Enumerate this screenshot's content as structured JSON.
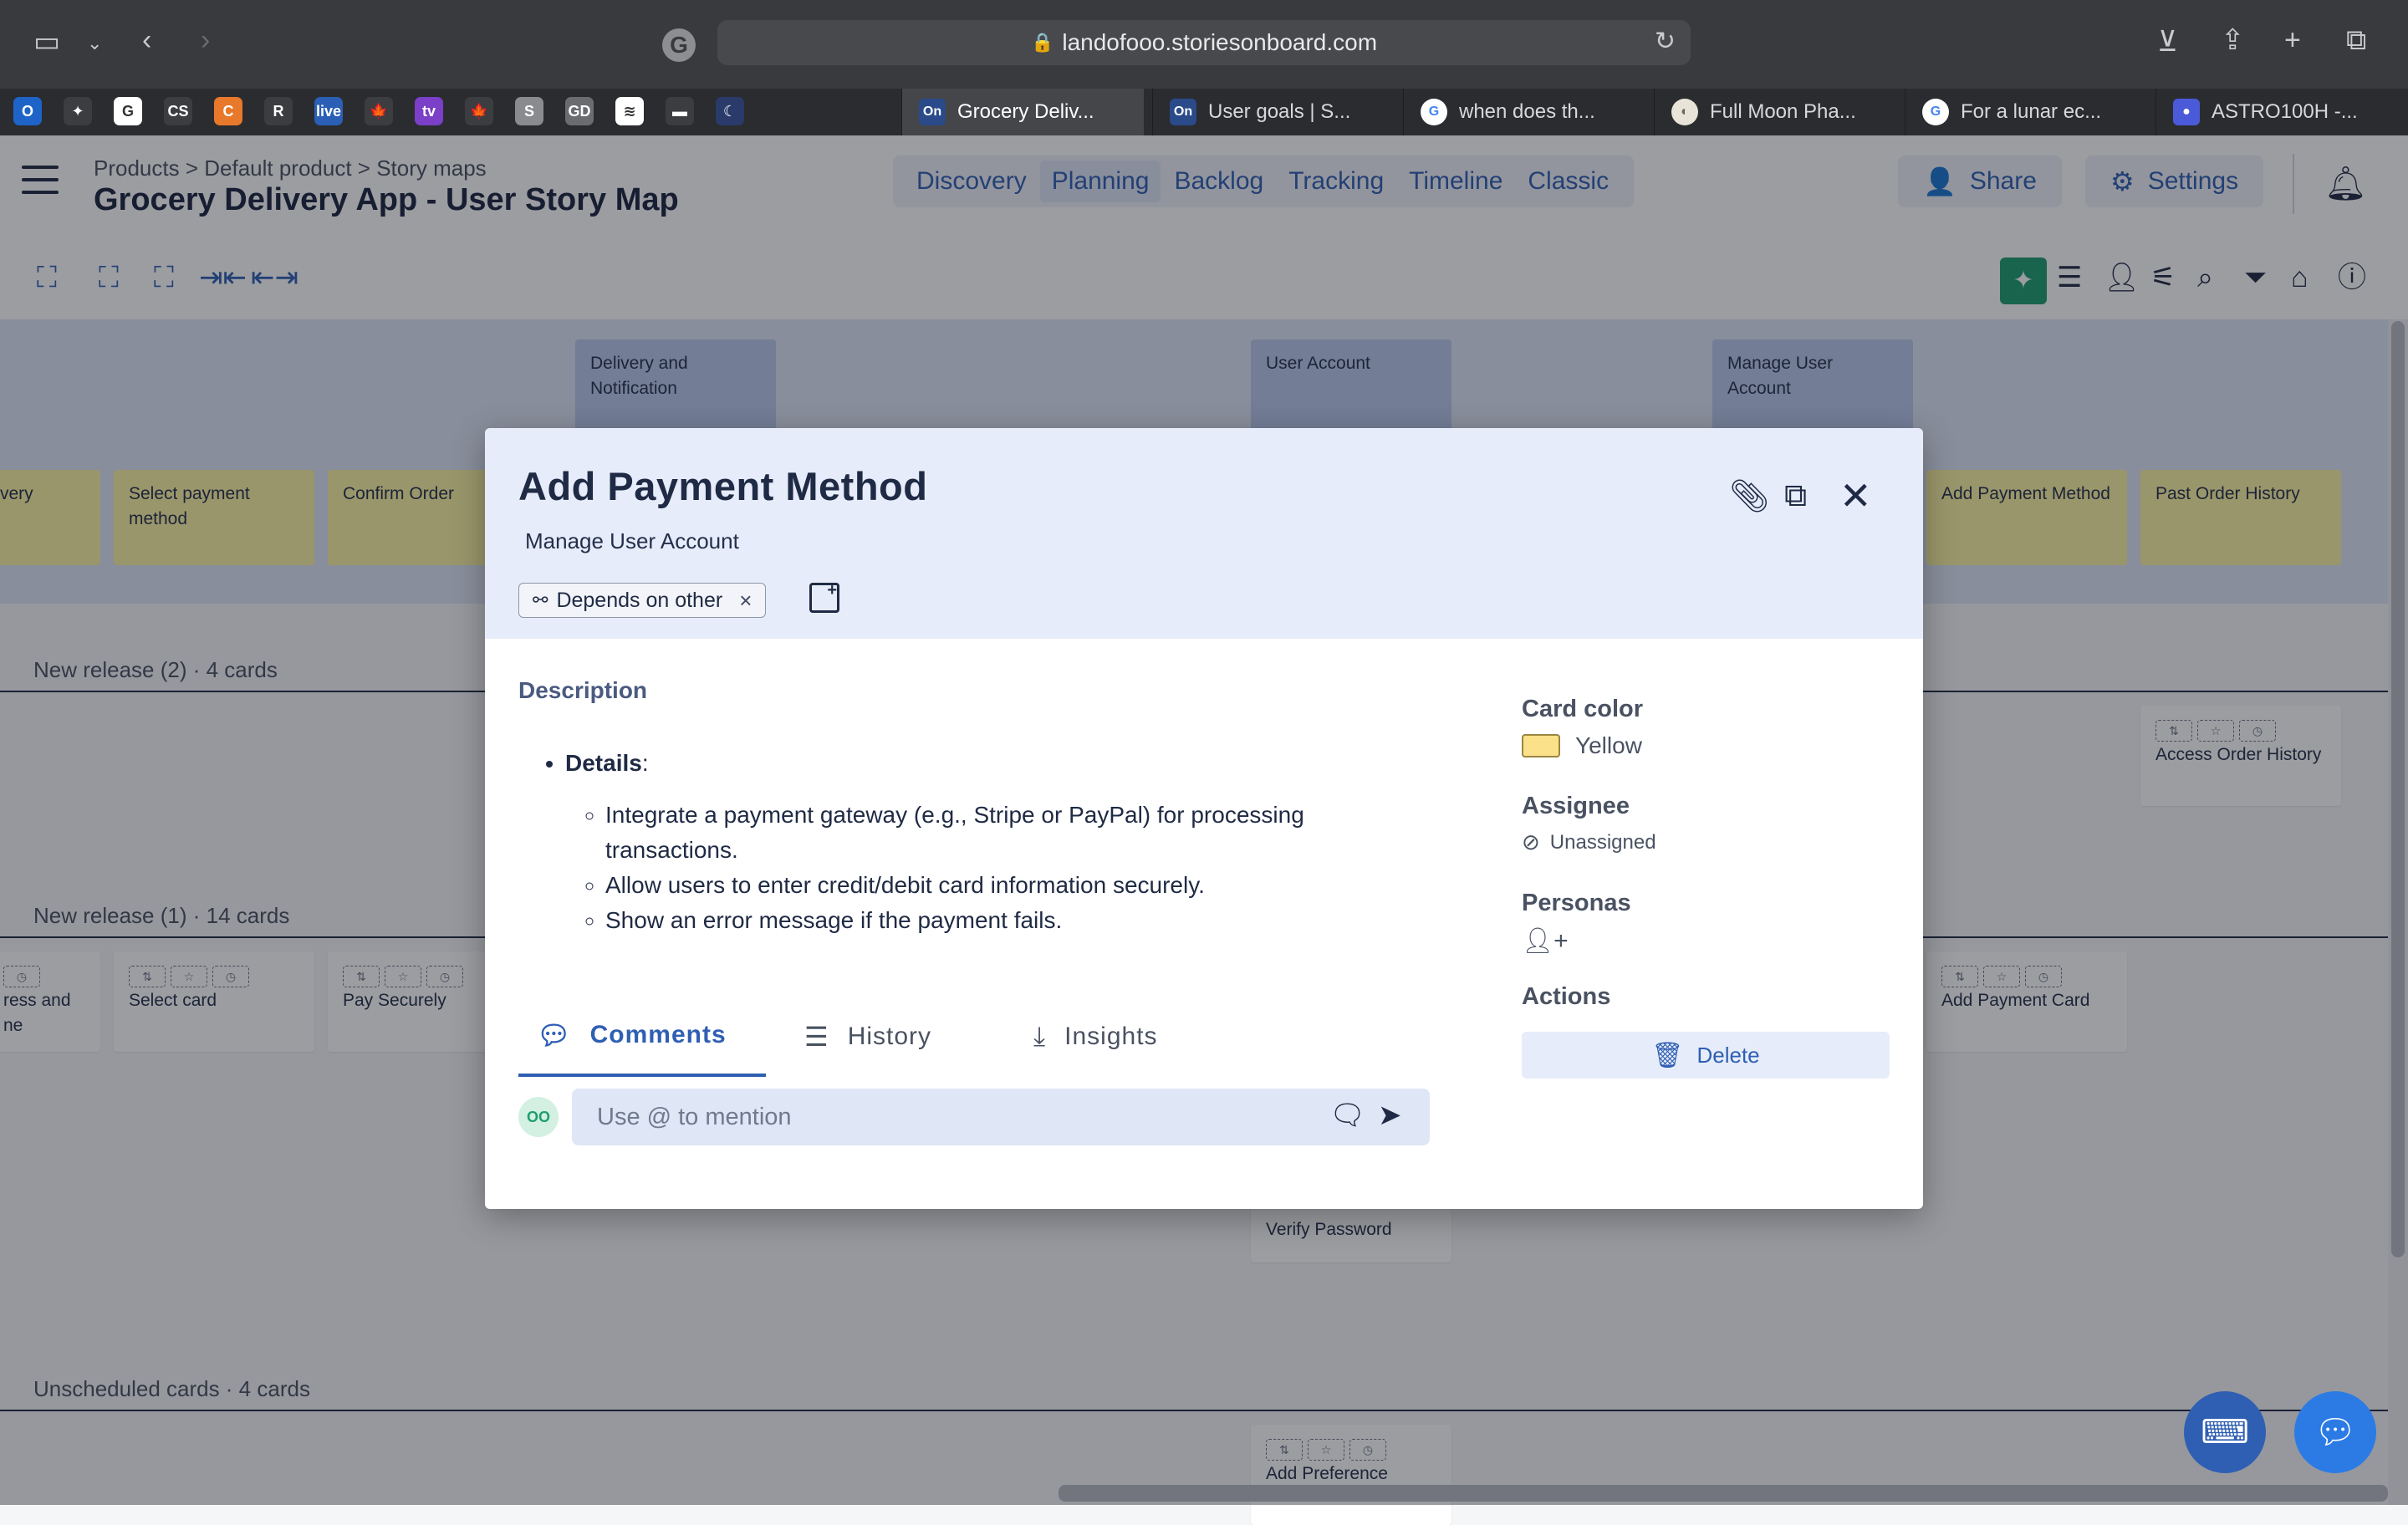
{
  "browser": {
    "url": "landofooo.storiesonboard.com",
    "tabs": [
      {
        "title": "Grocery Deliv...",
        "icon": "On",
        "active": true
      },
      {
        "title": "User goals | S...",
        "icon": "On",
        "active": false
      },
      {
        "title": "when does th...",
        "icon": "G",
        "active": false
      },
      {
        "title": "Full Moon Pha...",
        "icon": "moon",
        "active": false
      },
      {
        "title": "For a lunar ec...",
        "icon": "G",
        "active": false
      },
      {
        "title": "ASTRO100H -...",
        "icon": "circle",
        "active": false
      }
    ],
    "pinned": [
      "O",
      "✦",
      "G",
      "CS",
      "C",
      "R",
      "live",
      "🍁",
      "tv",
      "🍁",
      "S",
      "GD",
      "≋",
      "▬",
      "☾"
    ]
  },
  "header": {
    "breadcrumb": "Products > Default product > Story maps",
    "title": "Grocery Delivery App - User Story Map",
    "views": [
      "Discovery",
      "Planning",
      "Backlog",
      "Tracking",
      "Timeline",
      "Classic"
    ],
    "active_view": "Planning",
    "share_label": "Share",
    "settings_label": "Settings"
  },
  "board": {
    "activities": [
      {
        "label": "Delivery and Notification"
      },
      {
        "label": "User Account"
      },
      {
        "label": "Manage User Account"
      }
    ],
    "steps": [
      {
        "label": "very"
      },
      {
        "label": "Select payment method"
      },
      {
        "label": "Confirm Order"
      },
      {
        "label": "Add Payment Method"
      },
      {
        "label": "Past Order History"
      }
    ],
    "releases": [
      {
        "label": "New release (2) · 4 cards"
      },
      {
        "label": "New release (1) · 14 cards"
      },
      {
        "label": "Unscheduled cards · 4 cards"
      }
    ],
    "stories": [
      {
        "label": "Access Order History"
      },
      {
        "label": "ress and ne"
      },
      {
        "label": "Select card"
      },
      {
        "label": "Pay Securely"
      },
      {
        "label": "Add Payment Card"
      },
      {
        "label": "Verify Password"
      },
      {
        "label": "Add Preference"
      }
    ]
  },
  "modal": {
    "title": "Add Payment Method",
    "parent": "Manage User Account",
    "tag": "Depends on other",
    "description_heading": "Description",
    "details_label": "Details",
    "details_colon": ":",
    "details": [
      "Integrate a payment gateway (e.g., Stripe or PayPal) for processing transactions.",
      "Allow users to enter credit/debit card information securely.",
      "Show an error message if the payment fails."
    ],
    "tabs": [
      "Comments",
      "History",
      "Insights"
    ],
    "active_tab": "Comments",
    "avatar_initials": "OO",
    "comment_placeholder": "Use @ to mention",
    "card_color_label": "Card color",
    "card_color_value": "Yellow",
    "card_color_hex": "#fbe28a",
    "assignee_label": "Assignee",
    "assignee_value": "Unassigned",
    "personas_label": "Personas",
    "actions_label": "Actions",
    "delete_label": "Delete"
  },
  "colors": {
    "accent": "#2f5fb3",
    "ai_button": "#1e9e6f",
    "step_yellow": "#fbf3a2",
    "activity_blue": "#b9c9ec"
  }
}
